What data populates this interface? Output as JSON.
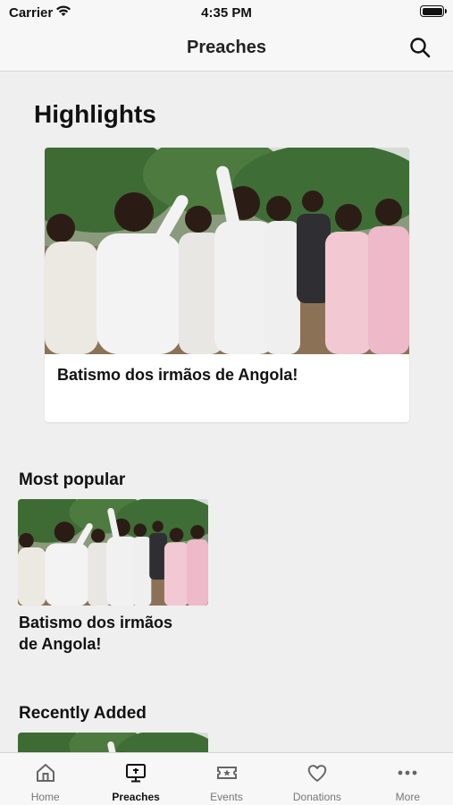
{
  "status_bar": {
    "carrier": "Carrier",
    "time": "4:35 PM"
  },
  "nav": {
    "title": "Preaches",
    "search_icon": "search-icon"
  },
  "highlights": {
    "title": "Highlights",
    "card": {
      "caption": "Batismo dos irmãos de Angola!"
    }
  },
  "most_popular": {
    "title": "Most popular",
    "card": {
      "caption": " Batismo dos irmãos\nde Angola!"
    }
  },
  "recently_added": {
    "title": "Recently Added"
  },
  "tab_bar": {
    "items": [
      {
        "label": "Home",
        "icon": "home-icon"
      },
      {
        "label": "Preaches",
        "icon": "monitor-icon",
        "active": true
      },
      {
        "label": "Events",
        "icon": "ticket-icon"
      },
      {
        "label": "Donations",
        "icon": "heart-icon"
      },
      {
        "label": "More",
        "icon": "more-icon"
      }
    ]
  },
  "colors": {
    "background": "#efefef",
    "bar": "#f7f7f7",
    "active": "#111111",
    "inactive": "#777777"
  }
}
